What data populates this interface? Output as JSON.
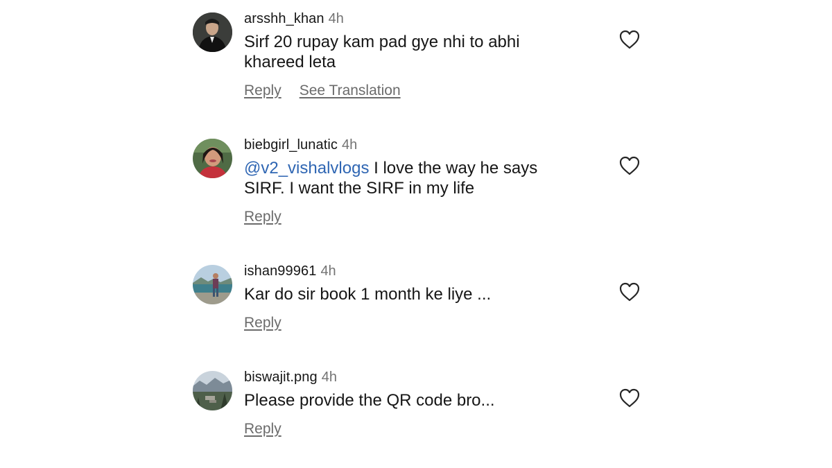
{
  "comments": [
    {
      "username": "arsshh_khan",
      "time": "4h",
      "text": "Sirf 20 rupay kam pad gye nhi to abhi khareed leta",
      "mention": "",
      "actions": {
        "reply": "Reply",
        "translate": "See Translation"
      },
      "avatar_icon": "profile-photo-man-in-suit"
    },
    {
      "username": "biebgirl_lunatic",
      "time": "4h",
      "mention": "@v2_vishalvlogs",
      "text": " I love the way he says SIRF. I want the SIRF in my life",
      "actions": {
        "reply": "Reply"
      },
      "avatar_icon": "profile-photo-woman-smiling"
    },
    {
      "username": "ishan99961",
      "time": "4h",
      "mention": "",
      "text": "Kar do sir book 1 month ke liye ...",
      "actions": {
        "reply": "Reply"
      },
      "avatar_icon": "profile-photo-man-by-lake"
    },
    {
      "username": "biswajit.png",
      "time": "4h",
      "mention": "",
      "text": "Please provide the QR code bro...",
      "actions": {
        "reply": "Reply"
      },
      "avatar_icon": "profile-photo-mountain-landscape"
    }
  ],
  "colors": {
    "text": "#161616",
    "muted": "#737373",
    "mention": "#2f66b3",
    "icon": "#262626"
  },
  "icons": {
    "like": "heart-outline-icon"
  }
}
